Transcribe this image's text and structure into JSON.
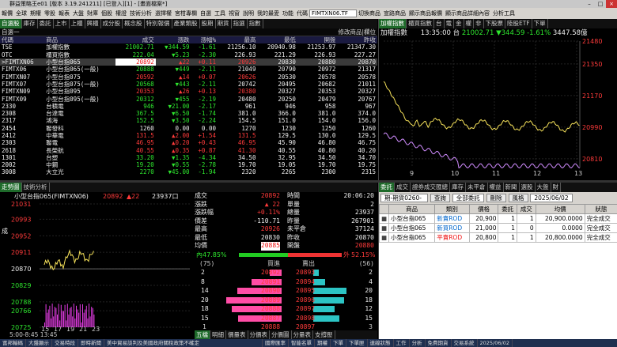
{
  "titlebar": {
    "title": "群益策略王e01 [版本 3.19.241211] [已登入][1] - [畫面檔案*]"
  },
  "menubar": {
    "items": [
      "報價",
      "全球",
      "期權",
      "零股",
      "報表",
      "大盤",
      "財庫",
      "個股",
      "權證",
      "技術分析",
      "選擇權",
      "宮柑專欄",
      "自選",
      "工具",
      "視窗",
      "說明",
      "我的最愛",
      "功能"
    ],
    "code_label": "代碼",
    "code_value": "FIMTXN06.TF",
    "right_items": [
      "切換商品",
      "宣路商品",
      "顯示商品報價",
      "顯示商品詳細內容",
      "分析工具"
    ]
  },
  "left_quote": {
    "tabs": [
      "自選股",
      "庫存",
      "委託",
      "上市",
      "上櫃",
      "興櫃",
      "成分股",
      "概念股",
      "特別報價",
      "產業類股",
      "股期",
      "期貨",
      "指選",
      "指數"
    ],
    "subtitle_left": "自選一",
    "subtitle_right": "修改商品|欄位",
    "columns": [
      "代碼",
      "商品",
      "成交",
      "漲跌",
      "漲幅%",
      "最高",
      "最低",
      "開盤",
      "昨收"
    ],
    "rows": [
      {
        "code": "TSE",
        "name": "加權指數",
        "price": "21002.71",
        "chg": "▼344.59",
        "pct": "-1.61",
        "high": "21256.10",
        "low": "20940.98",
        "open": "21253.97",
        "prev": "21347.30",
        "dir": "dn"
      },
      {
        "code": "OTC",
        "name": "櫃買指數",
        "price": "222.04",
        "chg": "▼5.23",
        "pct": "-2.30",
        "high": "226.93",
        "low": "221.29",
        "open": "226.93",
        "prev": "227.27",
        "dir": "dn"
      },
      {
        "code": ">FIMTXN06",
        "name": "小型台指065",
        "price": "20892",
        "chg": "▲22",
        "pct": "+0.11",
        "high": "20926",
        "low": "20830",
        "open": "20880",
        "prev": "20870",
        "dir": "up",
        "selected": true
      },
      {
        "code": "FIMTX06",
        "name": "小型台指065(一般)",
        "price": "20888",
        "chg": "▼449",
        "pct": "-2.11",
        "high": "21049",
        "low": "20790",
        "open": "20972",
        "prev": "21317",
        "dir": "dn"
      },
      {
        "code": "FIMTXN07",
        "name": "小型台指075",
        "price": "20592",
        "chg": "▲14",
        "pct": "+0.07",
        "high": "20626",
        "low": "20530",
        "open": "20578",
        "prev": "20578",
        "dir": "up"
      },
      {
        "code": "FIMTX07",
        "name": "小型台指075(一般)",
        "price": "20568",
        "chg": "▼443",
        "pct": "-2.11",
        "high": "20742",
        "low": "20495",
        "open": "20682",
        "prev": "21011",
        "dir": "dn"
      },
      {
        "code": "FIMTXN09",
        "name": "小型台指095",
        "price": "20353",
        "chg": "▲26",
        "pct": "+0.13",
        "high": "20380",
        "low": "20327",
        "open": "20353",
        "prev": "20327",
        "dir": "up"
      },
      {
        "code": "FIMTX09",
        "name": "小型台指095(一般)",
        "price": "20312",
        "chg": "▼455",
        "pct": "-2.19",
        "high": "20480",
        "low": "20250",
        "open": "20479",
        "prev": "20767",
        "dir": "dn"
      },
      {
        "code": "2330",
        "name": "台積電",
        "price": "946",
        "chg": "▼21.00",
        "pct": "-2.17",
        "high": "961",
        "low": "946",
        "open": "958",
        "prev": "967",
        "dir": "dn"
      },
      {
        "code": "2308",
        "name": "台達電",
        "price": "367.5",
        "chg": "▼6.50",
        "pct": "-1.74",
        "high": "381.0",
        "low": "366.0",
        "open": "381.0",
        "prev": "374.0",
        "dir": "dn"
      },
      {
        "code": "2317",
        "name": "鴻海",
        "price": "152.5",
        "chg": "▼3.50",
        "pct": "-2.24",
        "high": "154.5",
        "low": "151.0",
        "open": "154.0",
        "prev": "156.0",
        "dir": "dn"
      },
      {
        "code": "2454",
        "name": "聯發科",
        "price": "1260",
        "chg": "0.00",
        "pct": "0.00",
        "high": "1270",
        "low": "1230",
        "open": "1250",
        "prev": "1260",
        "dir": "flat"
      },
      {
        "code": "2412",
        "name": "中華電",
        "price": "131.5",
        "chg": "▲2.00",
        "pct": "+1.54",
        "high": "131.5",
        "low": "129.5",
        "open": "130.0",
        "prev": "129.5",
        "dir": "up"
      },
      {
        "code": "2303",
        "name": "聯電",
        "price": "46.95",
        "chg": "▲0.20",
        "pct": "+0.43",
        "high": "46.95",
        "low": "45.90",
        "open": "46.80",
        "prev": "46.75",
        "dir": "up"
      },
      {
        "code": "2618",
        "name": "長榮航",
        "price": "40.55",
        "chg": "▲0.35",
        "pct": "+0.87",
        "high": "41.30",
        "low": "40.55",
        "open": "40.80",
        "prev": "40.20",
        "dir": "up"
      },
      {
        "code": "1301",
        "name": "台塑",
        "price": "33.20",
        "chg": "▼1.35",
        "pct": "-4.34",
        "high": "34.50",
        "low": "32.95",
        "open": "34.50",
        "prev": "34.70",
        "dir": "dn"
      },
      {
        "code": "2002",
        "name": "中鋼",
        "price": "19.20",
        "chg": "▼0.55",
        "pct": "-2.78",
        "high": "19.70",
        "low": "19.05",
        "open": "19.70",
        "prev": "19.75",
        "dir": "dn"
      },
      {
        "code": "3008",
        "name": "大立光",
        "price": "2270",
        "chg": "▼45.00",
        "pct": "-1.94",
        "high": "2320",
        "low": "2265",
        "open": "2300",
        "prev": "2315",
        "dir": "dn"
      }
    ]
  },
  "index_chart": {
    "tabs": [
      "加權指數",
      "櫃買指數",
      "台",
      "電",
      "金",
      "權",
      "非",
      "下股票",
      "陸股ETF",
      "下單"
    ],
    "title": "加權指數",
    "time": "13:35:00",
    "label_price": "台",
    "price": "21002.71",
    "chg": "▼344.59",
    "pct": "-1.61%",
    "volume": "3447.58億",
    "y_ticks": [
      "21480",
      "21350",
      "21170",
      "20990",
      "20810"
    ],
    "x_ticks": [
      "9",
      "10",
      "11",
      "12",
      "13"
    ]
  },
  "futures_panel": {
    "tabs": [
      "走勢圖",
      "技術分析"
    ],
    "name": "小型台指065(FIMTXN06)",
    "price": "20892",
    "chg": "▲22",
    "volume": "23937口",
    "y_ticks": [
      "21031",
      "20993",
      "20952",
      "20911",
      "20870",
      "20829",
      "20788",
      "20766",
      "20725"
    ],
    "x_ticks": [
      "15",
      "17",
      "19",
      "21",
      "23"
    ],
    "time_range": "5:00-8:45 13:45",
    "left_side_label": "成",
    "info": [
      {
        "label": "成交",
        "value": "20892",
        "cls": "up",
        "label2": "時間",
        "value2": "20:06:20",
        "cls2": "wh"
      },
      {
        "label": "漲跌",
        "value": "▲ 22",
        "cls": "up",
        "label2": "單量",
        "value2": "2",
        "cls2": "wh"
      },
      {
        "label": "漲跌幅",
        "value": "+0.11%",
        "cls": "up",
        "label2": "總量",
        "value2": "23937",
        "cls2": "wh"
      },
      {
        "label": "價差",
        "value": "-110.71",
        "cls": "wh",
        "label2": "昨量",
        "value2": "267901",
        "cls2": "wh"
      },
      {
        "label": "最高",
        "value": "20926",
        "cls": "up",
        "label2": "未平倉",
        "value2": "37124",
        "cls2": "wh"
      },
      {
        "label": "最低",
        "value": "20830",
        "cls": "wh",
        "label2": "昨收",
        "value2": "20870",
        "cls2": "wh"
      },
      {
        "label": "均價",
        "value": "20885",
        "cls": "up",
        "label2": "開盤",
        "value2": "20880",
        "cls2": "up"
      }
    ],
    "inner_pct": "47.85%",
    "inner_label": "內",
    "outer_pct": "52.15%",
    "outer_label": "外",
    "bid_count": "(75)",
    "ask_count": "(56)",
    "bid_header": "買進",
    "ask_header": "賣出",
    "book": [
      {
        "bq": "2",
        "bp": "20892",
        "ap": "20893",
        "aq": "2",
        "bw": 22,
        "aw": 12
      },
      {
        "bq": "8",
        "bp": "20891",
        "ap": "20894",
        "aq": "4",
        "bw": 55,
        "aw": 25
      },
      {
        "bq": "14",
        "bp": "20890",
        "ap": "20895",
        "aq": "20",
        "bw": 80,
        "aw": 70
      },
      {
        "bq": "20",
        "bp": "20889",
        "ap": "20896",
        "aq": "18",
        "bw": 100,
        "aw": 65
      },
      {
        "bq": "18",
        "bp": "20888",
        "ap": "20897",
        "aq": "12",
        "bw": 90,
        "aw": 45
      },
      {
        "bq": "15",
        "bp": "20887",
        "ap": "20898",
        "aq": "15",
        "bw": 78,
        "aw": 55
      }
    ],
    "footer_left": "1",
    "footer_bp": "20888",
    "footer_ap": "20897",
    "footer_right": "3",
    "bottom_tabs": [
      "五檔",
      "明細",
      "價量表",
      "分價表",
      "分價圖",
      "分量表",
      "支撐壓"
    ]
  },
  "order_panel": {
    "tabs": [
      "委託",
      "成交",
      "證券成交匯總",
      "庫存",
      "未平倉",
      "權益",
      "新聞",
      "選股",
      "大盤",
      "財"
    ],
    "account_select": "期-期貨0260-",
    "query_btn": "查詢",
    "filter_select": "全部委託",
    "delete_btn": "刪除",
    "style_btn": "風格",
    "date": "2025/06/02",
    "columns": [
      "商品",
      "類別",
      "價格",
      "委託",
      "成交",
      "均價",
      "狀態"
    ],
    "rows": [
      {
        "name": "小型台指065",
        "type": "新賣ROD",
        "type_cls": "cy",
        "price": "20,900",
        "qty": "1",
        "filled": "1",
        "avg": "20,900.0000",
        "status": "完全成交"
      },
      {
        "name": "小型台指065",
        "type": "新買ROD",
        "type_cls": "cy",
        "price": "21,000",
        "qty": "1",
        "filled": "0",
        "avg": "0.0000",
        "status": "完全成交"
      },
      {
        "name": "小型台指065",
        "type": "平賣ROD",
        "type_cls": "up",
        "price": "20,800",
        "qty": "1",
        "filled": "1",
        "avg": "20,800.0000",
        "status": "完全成交"
      }
    ]
  },
  "taskbar": {
    "items": [
      "富邦輸碼",
      "大盤顯示",
      "交易時段",
      "即時新聞",
      "國際匯率",
      "智能名單",
      "期權",
      "下單",
      "下單匣",
      "連線狀態",
      "工作",
      "分析",
      "免費期貨",
      "交易系統"
    ],
    "news": "美中貿易談判及美國政府關稅政策不確定",
    "time": "2025/06/02"
  },
  "colors": {
    "up": "#ff3b3b",
    "down": "#2ee62e",
    "price_line": "#f5e15a",
    "avg_line": "#d08cff",
    "volume": "#e33ce3"
  }
}
